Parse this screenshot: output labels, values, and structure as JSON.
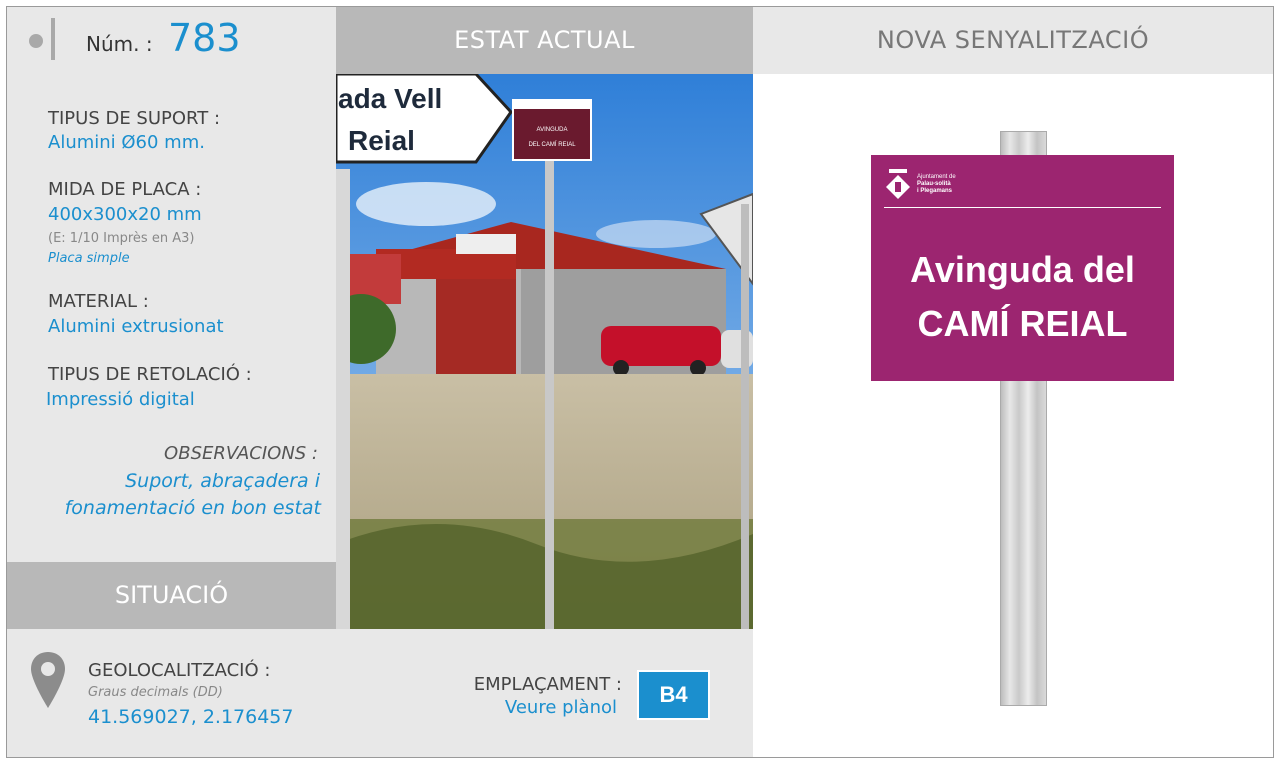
{
  "header": {
    "num_label": "Núm. :",
    "num_value": "783",
    "current_state": "ESTAT ACTUAL",
    "new_signage": "NOVA SENYALITZACIÓ"
  },
  "info": {
    "support_label": "TIPUS DE SUPORT :",
    "support_value": "Alumini Ø60 mm.",
    "plate_size_label": "MIDA DE PLACA :",
    "plate_size_value": "400x300x20 mm",
    "plate_scale_note": "(E: 1/10 Imprès en A3)",
    "plate_type_note": "Placa simple",
    "material_label": "MATERIAL :",
    "material_value": "Alumini extrusionat",
    "lettering_label": "TIPUS DE RETOLACIÓ :",
    "lettering_value": "Impressió digital",
    "observations_label": "OBSERVACIONS :",
    "observations_line1": "Suport, abraçadera i",
    "observations_line2": "fonamentació en bon estat"
  },
  "situation": {
    "title": "SITUACIÓ"
  },
  "geo": {
    "label": "GEOLOCALITZACIÓ :",
    "sublabel": "Graus decimals (DD)",
    "coords": "41.569027, 2.176457"
  },
  "placement": {
    "label": "EMPLAÇAMENT :",
    "link": "Veure plànol",
    "code": "B4"
  },
  "photo": {
    "arrow_sign_line1": "ada Vell",
    "arrow_sign_line2": "Reial",
    "small_sign_line1": "AVINGUDA",
    "small_sign_line2": "DEL CAMÍ REIAL"
  },
  "new_sign": {
    "logo_line1": "Ajuntament de",
    "logo_line2": "Palau-solità",
    "logo_line3": "i Plegamans",
    "line1": "Avinguda del",
    "line2": "CAMÍ REIAL",
    "plate_color": "#9c2570"
  },
  "colors": {
    "accent": "#1b8fce",
    "header_grey": "#b8b8b8",
    "panel_grey": "#e8e8e8"
  }
}
